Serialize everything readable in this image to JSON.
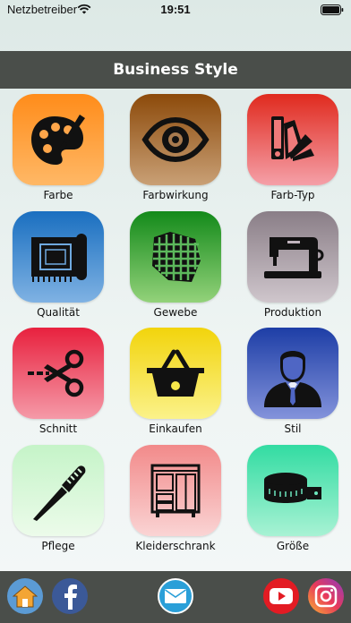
{
  "status": {
    "carrier": "Netzbetreiber",
    "time": "19:51"
  },
  "header": {
    "title": "Business Style"
  },
  "tiles": [
    {
      "label": "Farbe",
      "icon": "palette-icon",
      "gradient": [
        "#ff8c1a",
        "#ffb866"
      ]
    },
    {
      "label": "Farbwirkung",
      "icon": "eye-icon",
      "gradient": [
        "#8c4a0a",
        "#c9a076"
      ]
    },
    {
      "label": "Farb-Typ",
      "icon": "color-fan-icon",
      "gradient": [
        "#e02a1e",
        "#f5a0a8"
      ]
    },
    {
      "label": "Qualität",
      "icon": "fabric-roll-icon",
      "gradient": [
        "#1a6fc0",
        "#7fb2e3"
      ]
    },
    {
      "label": "Gewebe",
      "icon": "woven-fabric-icon",
      "gradient": [
        "#138a1a",
        "#93d27a"
      ]
    },
    {
      "label": "Produktion",
      "icon": "sewing-machine-icon",
      "gradient": [
        "#8a7e87",
        "#cfc6cc"
      ]
    },
    {
      "label": "Schnitt",
      "icon": "scissors-icon",
      "gradient": [
        "#e8213e",
        "#f59aa8"
      ]
    },
    {
      "label": "Einkaufen",
      "icon": "shopping-basket-icon",
      "gradient": [
        "#f2d40c",
        "#fbf28a"
      ]
    },
    {
      "label": "Stil",
      "icon": "businessman-icon",
      "gradient": [
        "#1d3ea6",
        "#8393db"
      ]
    },
    {
      "label": "Pflege",
      "icon": "brush-icon",
      "gradient": [
        "#c5f4c8",
        "#ecfbea"
      ]
    },
    {
      "label": "Kleiderschrank",
      "icon": "wardrobe-icon",
      "gradient": [
        "#f28a8a",
        "#fad4d4"
      ]
    },
    {
      "label": "Größe",
      "icon": "measuring-tape-icon",
      "gradient": [
        "#32dca2",
        "#a8f2d4"
      ]
    }
  ],
  "footer": {
    "buttons": [
      {
        "name": "home-button",
        "icon": "home-icon",
        "color": "#5b9bd5"
      },
      {
        "name": "facebook-button",
        "icon": "facebook-icon",
        "color": "#3b5998"
      },
      {
        "name": "mail-button",
        "icon": "mail-icon",
        "color": "#2a9fd8"
      },
      {
        "name": "youtube-button",
        "icon": "youtube-icon",
        "color": "#e31b23"
      },
      {
        "name": "instagram-button",
        "icon": "instagram-icon",
        "color": "#d6297a"
      }
    ]
  }
}
